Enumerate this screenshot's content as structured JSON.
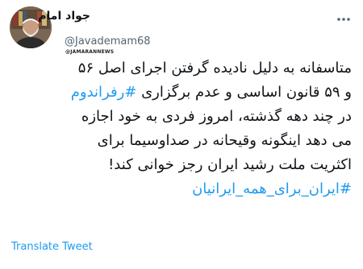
{
  "author": {
    "display_name": "جواد امام",
    "handle": "@Javademam68",
    "avatar_icon": "profile-photo"
  },
  "watermark": "@JAMARANNEWS",
  "tweet": {
    "line1": "متاسفانه به دلیل نادیده گرفتن اجرای اصل ۵۶",
    "line2_text": "و ۵۹ قانون اساسی و عدم برگزاری",
    "line2_hashtag": "#رفراندوم",
    "line3": "در چند دهه گذشته، امروز فردی به خود اجازه",
    "line4": "می دهد اینگونه وقیحانه در صداوسیما  برای",
    "line5": "اکثریت ملت رشید ایران رجز خوانی کند!",
    "hashtag_final": "#ایران_برای_همه_ایرانیان"
  },
  "translate_label": "Translate Tweet",
  "colors": {
    "link": "#1d9bf0",
    "text": "#0f1419",
    "secondary": "#536471"
  }
}
